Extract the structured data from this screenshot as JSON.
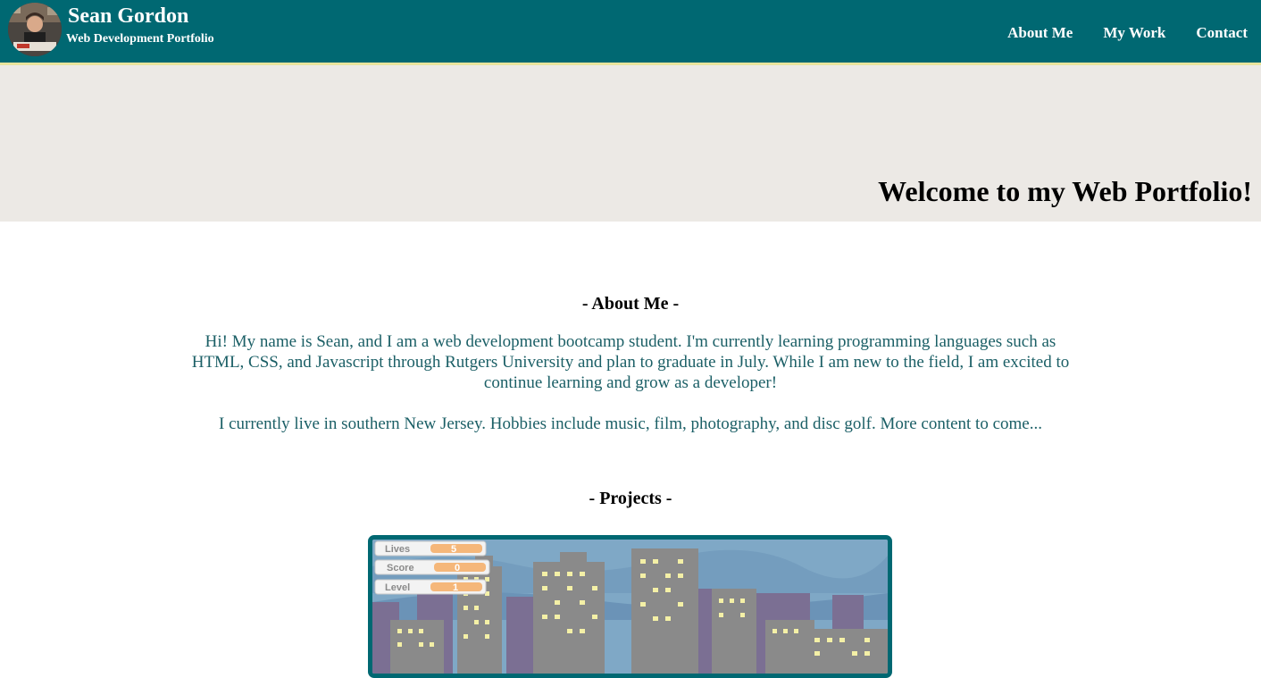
{
  "header": {
    "name": "Sean Gordon",
    "subtitle": "Web Development Portfolio",
    "nav": [
      {
        "label": "About Me"
      },
      {
        "label": "My Work"
      },
      {
        "label": "Contact"
      }
    ]
  },
  "hero": {
    "title": "Welcome to my Web Portfolio!"
  },
  "about": {
    "heading": "- About Me -",
    "paragraphs": [
      "Hi! My name is Sean, and I am a web development bootcamp student. I'm currently learning programming languages such as HTML, CSS, and Javascript through Rutgers University and plan to graduate in July. While I am new to the field, I am excited to continue learning and grow as a developer!",
      "I currently live in southern New Jersey. Hobbies include music, film, photography, and disc golf. More content to come..."
    ]
  },
  "projects": {
    "heading": "- Projects -",
    "game_hud": {
      "lives_label": "Lives",
      "lives_value": "5",
      "score_label": "Score",
      "score_value": "0",
      "level_label": "Level",
      "level_value": "1"
    }
  },
  "colors": {
    "header_bg": "#006872",
    "header_border": "#e9e39c",
    "hero_bg": "#ece9e5",
    "body_text": "#1b5f66"
  }
}
